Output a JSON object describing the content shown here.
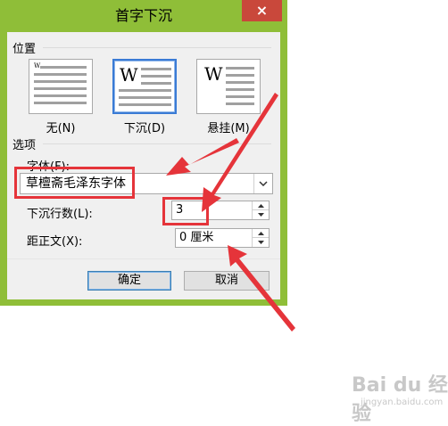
{
  "dialog": {
    "title": "首字下沉",
    "close_symbol": "×"
  },
  "position_group": {
    "label": "位置",
    "options": [
      {
        "label": "无(N)",
        "selected": false
      },
      {
        "label": "下沉(D)",
        "selected": true
      },
      {
        "label": "悬挂(M)",
        "selected": false
      }
    ],
    "glyph": "W"
  },
  "options_group": {
    "label": "选项",
    "font_label": "字体(F):",
    "font_value": "草檀斋毛泽东字体",
    "lines_label": "下沉行数(L):",
    "lines_value": "3",
    "distance_label": "距正文(X):",
    "distance_value": "0 厘米"
  },
  "buttons": {
    "ok": "确定",
    "cancel": "取消"
  },
  "annotation_colors": {
    "highlight": "#e5343a",
    "frame": "#8fbe38"
  },
  "watermark": {
    "text": "Bai du 经验",
    "sub": "jingyan.baidu.com"
  }
}
